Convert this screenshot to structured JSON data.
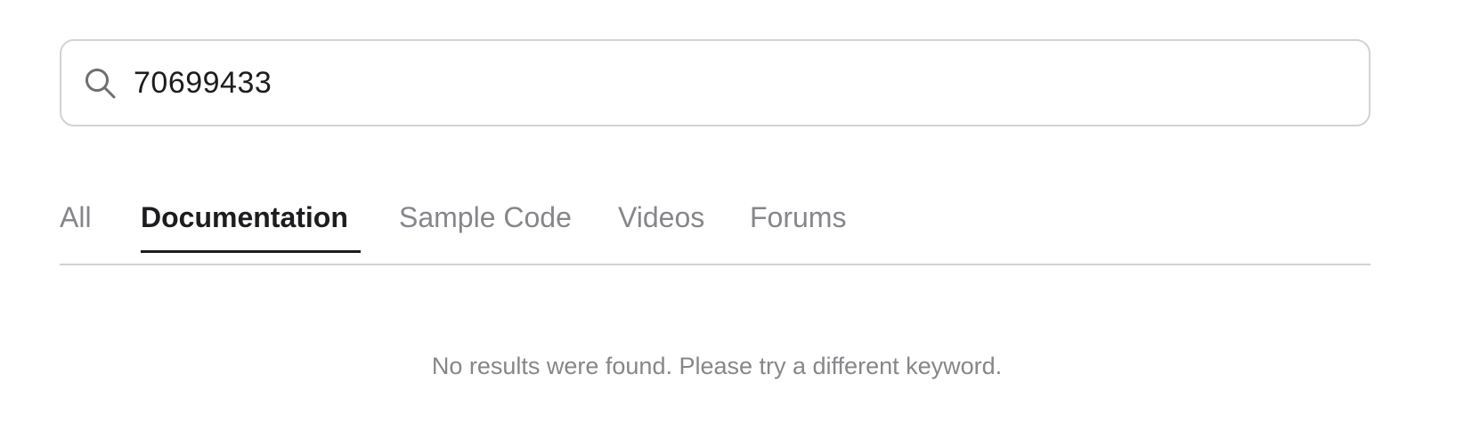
{
  "search": {
    "value": "70699433",
    "icon": "search-icon"
  },
  "tabs": [
    {
      "label": "All",
      "active": false
    },
    {
      "label": "Documentation",
      "active": true
    },
    {
      "label": "Sample Code",
      "active": false
    },
    {
      "label": "Videos",
      "active": false
    },
    {
      "label": "Forums",
      "active": false
    }
  ],
  "results": {
    "empty_message": "No results were found. Please try a different keyword."
  },
  "colors": {
    "border": "#d2d2d7",
    "text_primary": "#1d1d1f",
    "text_secondary": "#86868b",
    "icon": "#6e6e73"
  }
}
